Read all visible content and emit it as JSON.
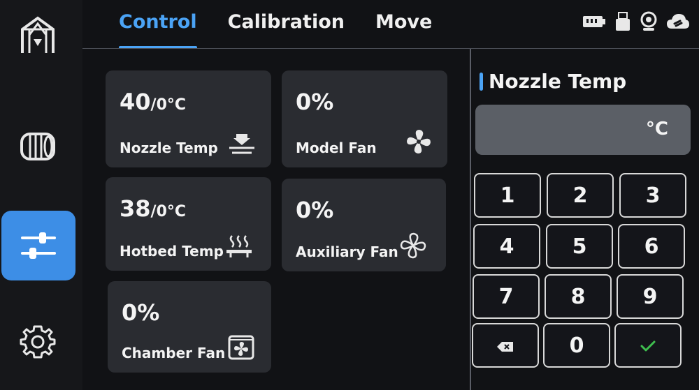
{
  "sidebar": {
    "items": [
      {
        "name": "printer",
        "icon": "printer-frame-icon",
        "active": false
      },
      {
        "name": "filament",
        "icon": "filament-spool-icon",
        "active": false
      },
      {
        "name": "control",
        "icon": "sliders-icon",
        "active": true
      },
      {
        "name": "settings",
        "icon": "gear-icon",
        "active": false
      }
    ],
    "active_color": "#3d8ee6"
  },
  "tabs": [
    {
      "label": "Control",
      "active": true
    },
    {
      "label": "Calibration",
      "active": false
    },
    {
      "label": "Move",
      "active": false
    }
  ],
  "status_icons": [
    "card-reader-icon",
    "usb-drive-icon",
    "camera-icon",
    "cloud-link-icon"
  ],
  "cards": {
    "nozzle": {
      "value": "40",
      "target": "/0°C",
      "label": "Nozzle Temp",
      "icon": "nozzle-icon"
    },
    "model_fan": {
      "value": "0%",
      "label": "Model Fan",
      "icon": "fan-icon"
    },
    "hotbed": {
      "value": "38",
      "target": "/0°C",
      "label": "Hotbed Temp",
      "icon": "hotbed-icon"
    },
    "aux_fan": {
      "value": "0%",
      "label": "Auxiliary Fan",
      "icon": "fan-outline-icon"
    },
    "chamber_fan": {
      "value": "0%",
      "label": "Chamber Fan",
      "icon": "chamber-fan-icon"
    }
  },
  "keypad": {
    "title": "Nozzle Temp",
    "input_value": "",
    "unit": "°C",
    "keys": [
      "1",
      "2",
      "3",
      "4",
      "5",
      "6",
      "7",
      "8",
      "9"
    ],
    "zero": "0",
    "backspace_icon": "backspace-icon",
    "confirm_icon": "check-icon"
  },
  "colors": {
    "accent": "#4ba3f5",
    "confirm": "#3fbf4f"
  }
}
